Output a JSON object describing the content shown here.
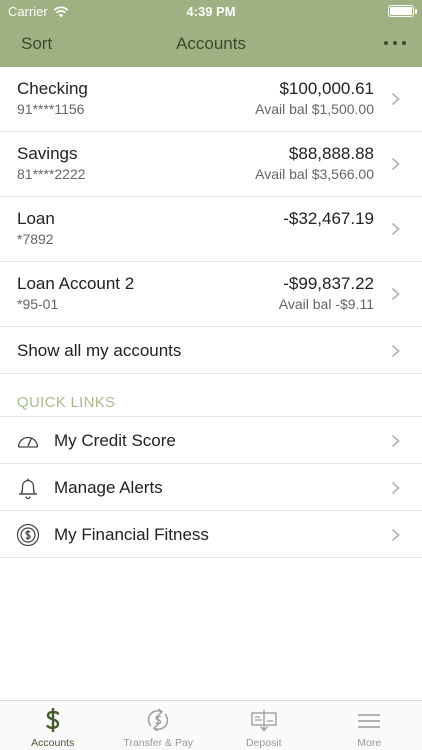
{
  "status_bar": {
    "carrier": "Carrier",
    "time": "4:39 PM"
  },
  "navbar": {
    "sort_label": "Sort",
    "title": "Accounts"
  },
  "accounts": [
    {
      "name": "Checking",
      "number": "91****1156",
      "balance": "$100,000.61",
      "available": "Avail bal $1,500.00"
    },
    {
      "name": "Savings",
      "number": "81****2222",
      "balance": "$88,888.88",
      "available": "Avail bal $3,566.00"
    },
    {
      "name": "Loan",
      "number": "*7892",
      "balance": "-$32,467.19",
      "available": ""
    },
    {
      "name": "Loan Account 2",
      "number": "*95-01",
      "balance": "-$99,837.22",
      "available": "Avail bal -$9.11"
    }
  ],
  "show_all_label": "Show all my accounts",
  "quick_links": {
    "title": "QUICK LINKS",
    "items": [
      {
        "label": "My Credit Score",
        "icon": "speedometer-icon"
      },
      {
        "label": "Manage Alerts",
        "icon": "bell-icon"
      },
      {
        "label": "My Financial Fitness",
        "icon": "dollar-coin-icon"
      }
    ]
  },
  "tabbar": {
    "tabs": [
      {
        "label": "Accounts",
        "icon": "dollar-icon",
        "active": true
      },
      {
        "label": "Transfer & Pay",
        "icon": "transfer-icon",
        "active": false
      },
      {
        "label": "Deposit",
        "icon": "check-deposit-icon",
        "active": false
      },
      {
        "label": "More",
        "icon": "hamburger-menu-icon",
        "active": false
      }
    ]
  },
  "colors": {
    "header_bg": "#9fb082",
    "accent_dark": "#4a5a30",
    "quick_links_title": "#a8bb88"
  }
}
